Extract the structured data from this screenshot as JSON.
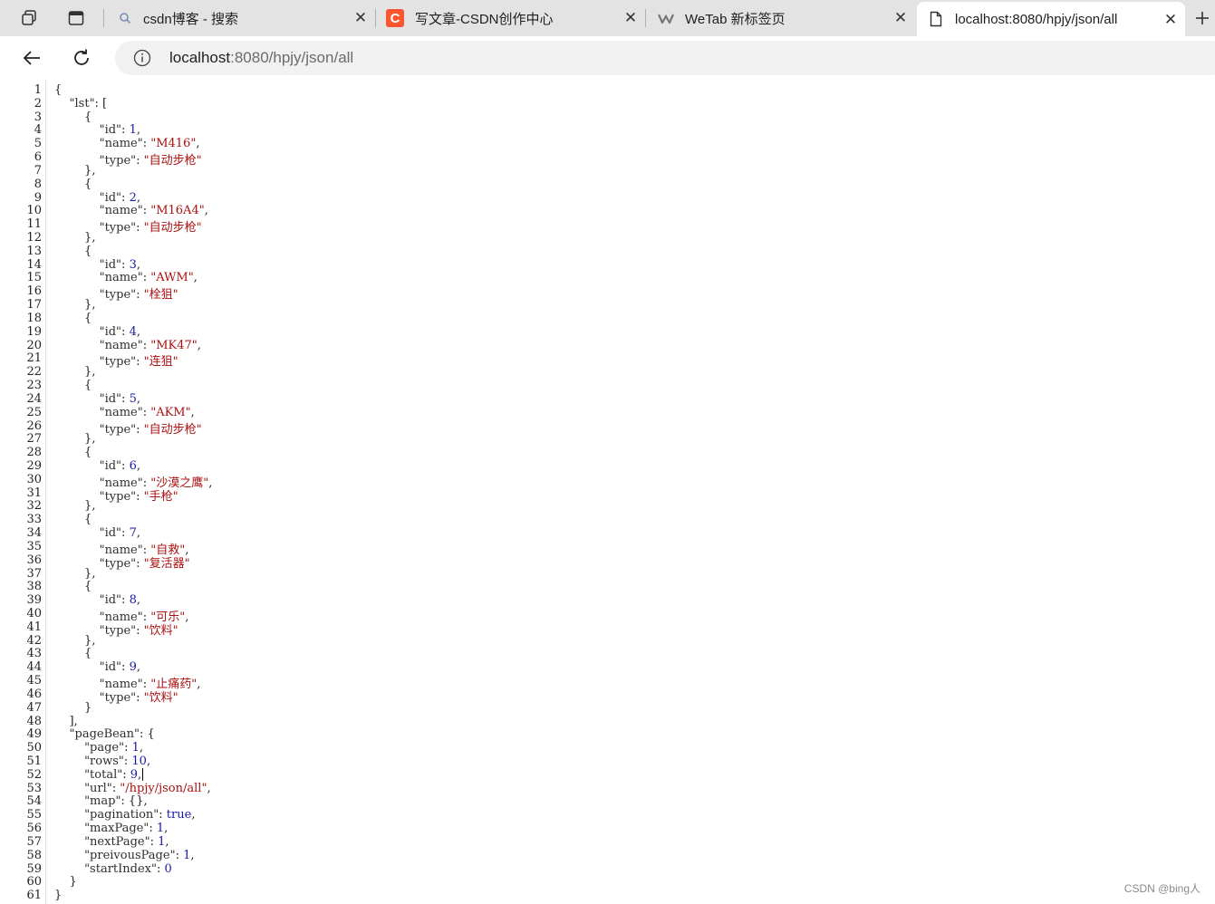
{
  "browser": {
    "tabs": [
      {
        "label": "csdn博客 - 搜索",
        "icon": "search-icon"
      },
      {
        "label": "写文章-CSDN创作中心",
        "icon": "csdn-icon",
        "accent": "#fc5531"
      },
      {
        "label": "WeTab 新标签页",
        "icon": "wetab-icon"
      },
      {
        "label": "localhost:8080/hpjy/json/all",
        "icon": "page-icon"
      }
    ],
    "url_host": "localhost",
    "url_path": ":8080/hpjy/json/all"
  },
  "json_view": {
    "lines": [
      "{",
      "    \"lst\": [",
      "        {",
      "            \"id\": 1,",
      "            \"name\": \"M416\",",
      "            \"type\": \"自动步枪\"",
      "        },",
      "        {",
      "            \"id\": 2,",
      "            \"name\": \"M16A4\",",
      "            \"type\": \"自动步枪\"",
      "        },",
      "        {",
      "            \"id\": 3,",
      "            \"name\": \"AWM\",",
      "            \"type\": \"栓狙\"",
      "        },",
      "        {",
      "            \"id\": 4,",
      "            \"name\": \"MK47\",",
      "            \"type\": \"连狙\"",
      "        },",
      "        {",
      "            \"id\": 5,",
      "            \"name\": \"AKM\",",
      "            \"type\": \"自动步枪\"",
      "        },",
      "        {",
      "            \"id\": 6,",
      "            \"name\": \"沙漠之鹰\",",
      "            \"type\": \"手枪\"",
      "        },",
      "        {",
      "            \"id\": 7,",
      "            \"name\": \"自救\",",
      "            \"type\": \"复活器\"",
      "        },",
      "        {",
      "            \"id\": 8,",
      "            \"name\": \"可乐\",",
      "            \"type\": \"饮料\"",
      "        },",
      "        {",
      "            \"id\": 9,",
      "            \"name\": \"止痛药\",",
      "            \"type\": \"饮料\"",
      "        }",
      "    ],",
      "    \"pageBean\": {",
      "        \"page\": 1,",
      "        \"rows\": 10,",
      "        \"total\": 9,",
      "        \"url\": \"/hpjy/json/all\",",
      "        \"map\": {},",
      "        \"pagination\": true,",
      "        \"maxPage\": 1,",
      "        \"nextPage\": 1,",
      "        \"preivousPage\": 1,",
      "        \"startIndex\": 0",
      "    }",
      "}"
    ]
  },
  "watermark": "CSDN @bing人"
}
